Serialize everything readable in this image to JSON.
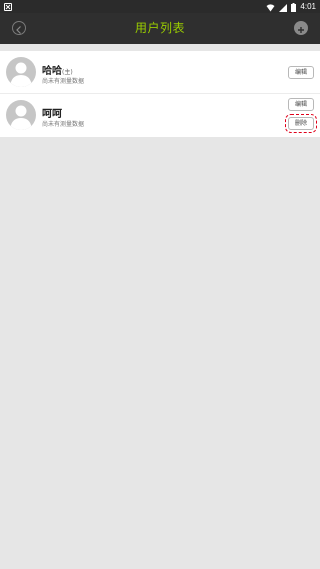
{
  "statusbar": {
    "time": "4:01"
  },
  "header": {
    "title": "用户列表",
    "back_icon": "chevron-left-icon",
    "add_icon": "plus-circle-icon"
  },
  "users": [
    {
      "name": "哈哈",
      "tag": "(主)",
      "subtitle": "尚未有测量数据",
      "edit_label": "编辑"
    },
    {
      "name": "呵呵",
      "tag": "",
      "subtitle": "尚未有测量数据",
      "edit_label": "编辑",
      "delete_label": "删除"
    }
  ],
  "colors": {
    "title": "#9acd00",
    "header_bg": "#2f2f2f",
    "highlight": "#e0001a"
  }
}
